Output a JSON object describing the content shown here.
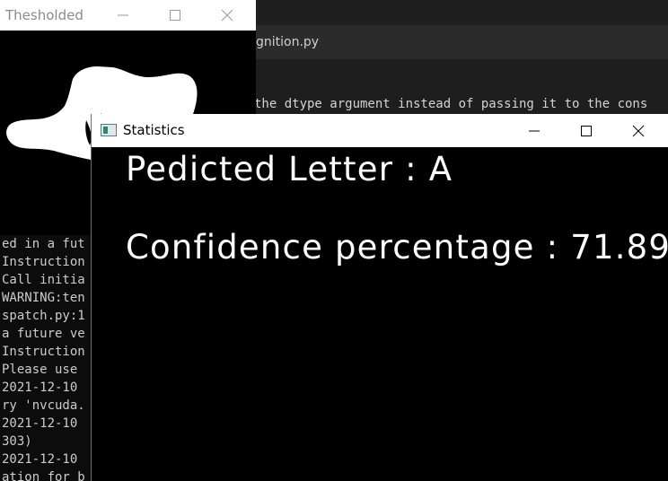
{
  "editor": {
    "tab_label": "gnition.py",
    "code_line": "the dtype argument instead of passing it to the cons"
  },
  "console": {
    "lines": [
      "ed in a fut",
      "Instruction",
      "Call initia",
      "WARNING:ten",
      "spatch.py:1",
      "a future ve",
      "Instruction",
      "Please use ",
      "2021-12-10 ",
      "ry 'nvcuda.",
      "2021-12-10 ",
      "303)",
      "2021-12-10 ",
      "ation for b"
    ]
  },
  "thresholded_window": {
    "title": "Thesholded"
  },
  "statistics_window": {
    "title": "Statistics",
    "predicted_letter": "Pedicted Letter : A",
    "confidence": "Confidence percentage : 71.89"
  },
  "colors": {
    "window_bg": "#000000",
    "titlebar_bg": "#ffffff",
    "editor_bg": "#1e1e1e",
    "accent_green": "#4caf50"
  }
}
